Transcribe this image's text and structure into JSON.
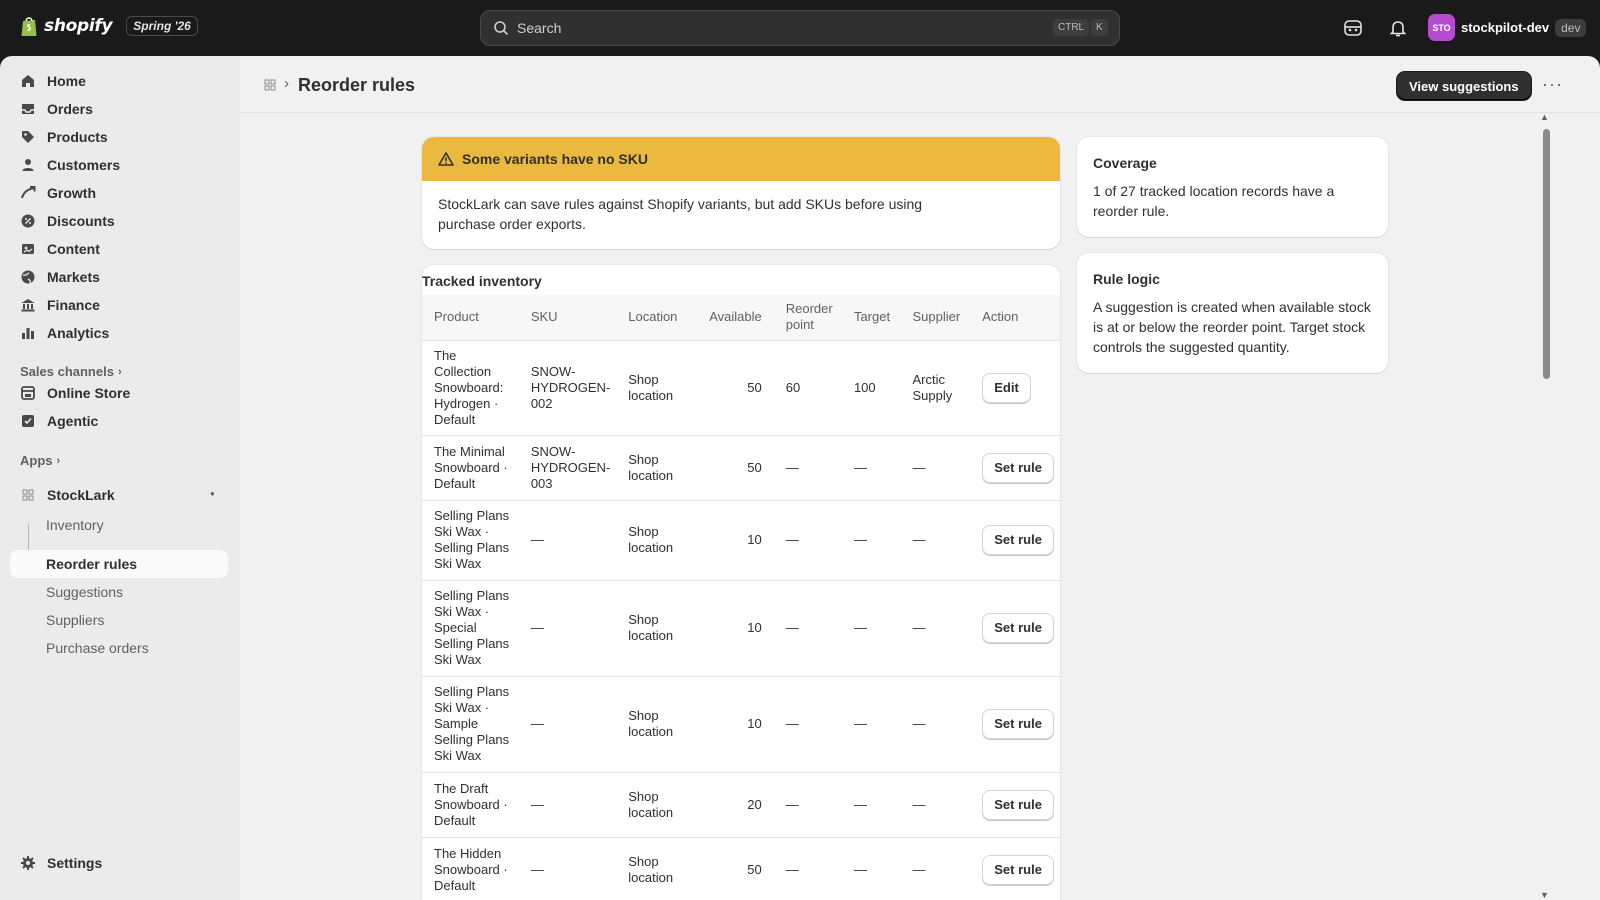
{
  "topbar": {
    "brand": "shopify",
    "edition": "Spring '26",
    "search_placeholder": "Search",
    "shortcut_ctrl": "CTRL",
    "shortcut_key": "K",
    "store_initials": "STO",
    "store_name": "stockpilot-dev",
    "store_badge": "dev"
  },
  "sidebar": {
    "main_items": [
      {
        "label": "Home",
        "icon": "home-icon"
      },
      {
        "label": "Orders",
        "icon": "orders-icon"
      },
      {
        "label": "Products",
        "icon": "tag-icon"
      },
      {
        "label": "Customers",
        "icon": "person-icon"
      },
      {
        "label": "Growth",
        "icon": "growth-icon"
      },
      {
        "label": "Discounts",
        "icon": "discount-icon"
      },
      {
        "label": "Content",
        "icon": "content-icon"
      },
      {
        "label": "Markets",
        "icon": "globe-icon"
      },
      {
        "label": "Finance",
        "icon": "bank-icon"
      },
      {
        "label": "Analytics",
        "icon": "chart-icon"
      }
    ],
    "sales_channels_label": "Sales channels",
    "channels": [
      {
        "label": "Online Store",
        "icon": "store-icon"
      },
      {
        "label": "Agentic",
        "icon": "agentic-icon"
      }
    ],
    "apps_label": "Apps",
    "app_name": "StockLark",
    "app_subitems": [
      "Inventory",
      "Reorder rules",
      "Suggestions",
      "Suppliers",
      "Purchase orders"
    ],
    "settings_label": "Settings"
  },
  "page": {
    "title": "Reorder rules",
    "primary_action": "View suggestions"
  },
  "banner": {
    "title": "Some variants have no SKU",
    "body": "StockLark can save rules against Shopify variants, but add SKUs before using purchase order exports."
  },
  "table": {
    "title": "Tracked inventory",
    "headers": [
      "Product",
      "SKU",
      "Location",
      "Available",
      "Reorder point",
      "Target",
      "Supplier",
      "Action"
    ],
    "rows": [
      {
        "product": "The Collection Snowboard: Hydrogen · Default",
        "sku": "SNOW-HYDROGEN-002",
        "location": "Shop location",
        "available": "50",
        "reorder": "60",
        "target": "100",
        "supplier": "Arctic Supply",
        "action": "Edit"
      },
      {
        "product": "The Minimal Snowboard · Default",
        "sku": "SNOW-HYDROGEN-003",
        "location": "Shop location",
        "available": "50",
        "reorder": "—",
        "target": "—",
        "supplier": "—",
        "action": "Set rule"
      },
      {
        "product": "Selling Plans Ski Wax · Selling Plans Ski Wax",
        "sku": "—",
        "location": "Shop location",
        "available": "10",
        "reorder": "—",
        "target": "—",
        "supplier": "—",
        "action": "Set rule"
      },
      {
        "product": "Selling Plans Ski Wax · Special Selling Plans Ski Wax",
        "sku": "—",
        "location": "Shop location",
        "available": "10",
        "reorder": "—",
        "target": "—",
        "supplier": "—",
        "action": "Set rule"
      },
      {
        "product": "Selling Plans Ski Wax · Sample Selling Plans Ski Wax",
        "sku": "—",
        "location": "Shop location",
        "available": "10",
        "reorder": "—",
        "target": "—",
        "supplier": "—",
        "action": "Set rule"
      },
      {
        "product": "The Draft Snowboard · Default",
        "sku": "—",
        "location": "Shop location",
        "available": "20",
        "reorder": "—",
        "target": "—",
        "supplier": "—",
        "action": "Set rule"
      },
      {
        "product": "The Hidden Snowboard · Default",
        "sku": "—",
        "location": "Shop location",
        "available": "50",
        "reorder": "—",
        "target": "—",
        "supplier": "—",
        "action": "Set rule"
      }
    ]
  },
  "coverage": {
    "title": "Coverage",
    "text": "1 of 27 tracked location records have a reorder rule."
  },
  "rule_logic": {
    "title": "Rule logic",
    "text": "A suggestion is created when available stock is at or below the reorder point. Target stock controls the suggested quantity."
  },
  "colors": {
    "banner_warning": "#ebb840",
    "avatar": "#b44cd0",
    "topbar": "#1a1a1a"
  }
}
